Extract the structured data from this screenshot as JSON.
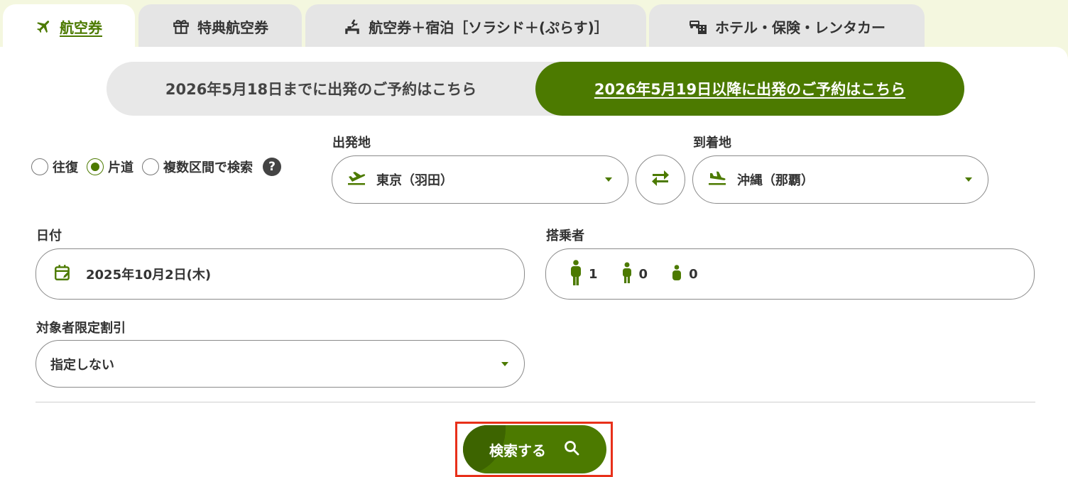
{
  "tabs": [
    {
      "label": "航空券",
      "icon": "airplane-icon",
      "active": true
    },
    {
      "label": "特典航空券",
      "icon": "gift-icon",
      "active": false
    },
    {
      "label": "航空券＋宿泊［ソラシド＋(ぷらす)］",
      "icon": "flight-hotel-icon",
      "active": false
    },
    {
      "label": "ホテル・保険・レンタカー",
      "icon": "car-hotel-icon",
      "active": false
    }
  ],
  "date_toggle": {
    "left_label": "2026年5月18日までに出発のご予約はこちら",
    "right_label": "2026年5月19日以降に出発のご予約はこちら",
    "selected": "right"
  },
  "trip_type": {
    "options": [
      "往復",
      "片道",
      "複数区間で検索"
    ],
    "selected": "片道",
    "help_label": "?"
  },
  "origin": {
    "label": "出発地",
    "value": "東京（羽田）"
  },
  "destination": {
    "label": "到着地",
    "value": "沖縄（那覇）"
  },
  "date": {
    "label": "日付",
    "value": "2025年10月2日(木)"
  },
  "passengers": {
    "label": "搭乗者",
    "adult": "1",
    "child": "0",
    "infant": "0"
  },
  "discount": {
    "label": "対象者限定割引",
    "value": "指定しない"
  },
  "search": {
    "label": "検索する"
  },
  "colors": {
    "accent": "#4c7a00",
    "highlight": "#e8301a",
    "background": "#f4f7df"
  }
}
